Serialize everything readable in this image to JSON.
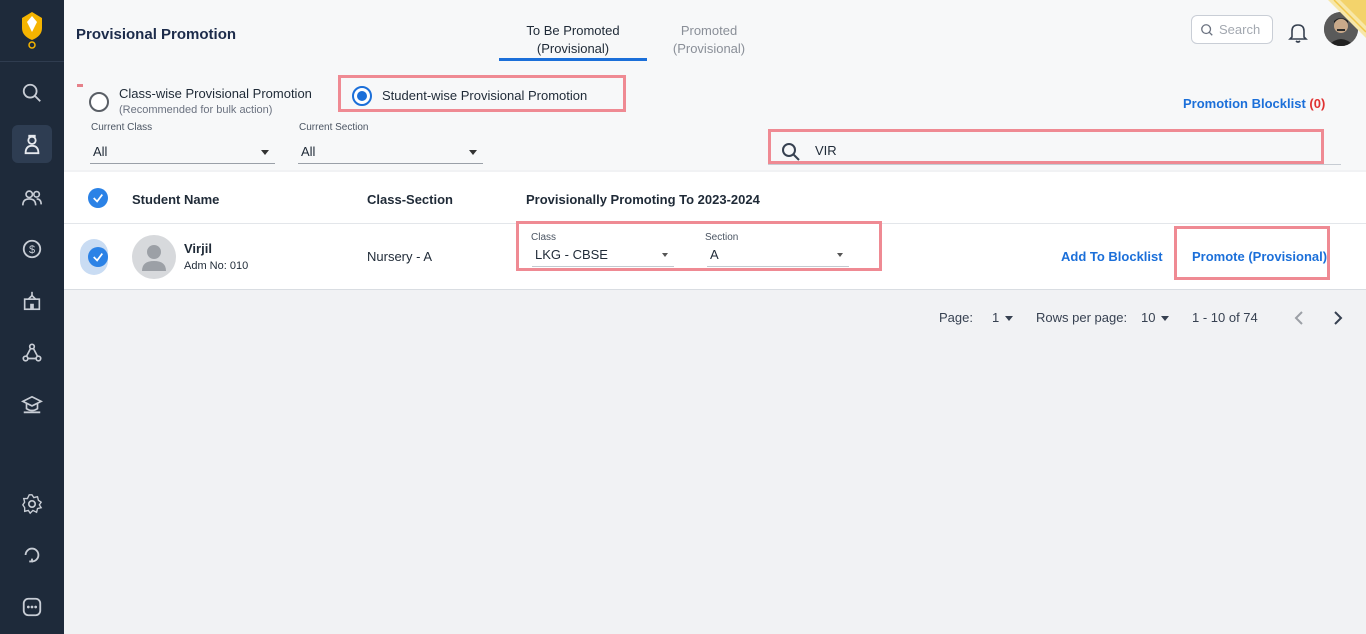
{
  "sidebar": {
    "items": [
      "search-icon",
      "student-icon",
      "people-icon",
      "fees-icon",
      "school-icon",
      "network-icon",
      "academics-icon",
      "settings-icon",
      "refresh-icon",
      "more-icon"
    ],
    "active": "student-icon"
  },
  "header": {
    "title": "Provisional Promotion",
    "tabs": [
      {
        "label_line1": "To Be Promoted",
        "label_line2": "(Provisional)",
        "active": true
      },
      {
        "label_line1": "Promoted",
        "label_line2": "(Provisional)",
        "active": false
      }
    ],
    "search_placeholder": "Search"
  },
  "options": {
    "classwise_label": "Class-wise Provisional Promotion",
    "classwise_sub": "(Recommended for bulk action)",
    "studentwise_label": "Student-wise Provisional Promotion",
    "selected": "studentwise"
  },
  "blocklist": {
    "label": "Promotion Blocklist",
    "count": "(0)"
  },
  "filters": {
    "current_class_label": "Current Class",
    "current_class_value": "All",
    "current_section_label": "Current Section",
    "current_section_value": "All",
    "search_value": "VIR"
  },
  "table": {
    "headers": {
      "student_name": "Student Name",
      "class_section": "Class-Section",
      "promoting_to": "Provisionally Promoting To 2023-2024"
    },
    "rows": [
      {
        "name": "Virjil",
        "adm": "Adm No: 010",
        "class_section": "Nursery - A",
        "class_label": "Class",
        "class_value": "LKG - CBSE",
        "section_label": "Section",
        "section_value": "A",
        "add_blocklist": "Add To Blocklist",
        "promote": "Promote (Provisional)"
      }
    ]
  },
  "pagination": {
    "page_label": "Page:",
    "page_value": "1",
    "rows_label": "Rows per page:",
    "rows_value": "10",
    "range": "1 - 10 of 74"
  },
  "colors": {
    "sidebar": "#1e2a3a",
    "accent": "#1b6fd9",
    "highlight": "#ef8a93",
    "count": "#e03131"
  }
}
